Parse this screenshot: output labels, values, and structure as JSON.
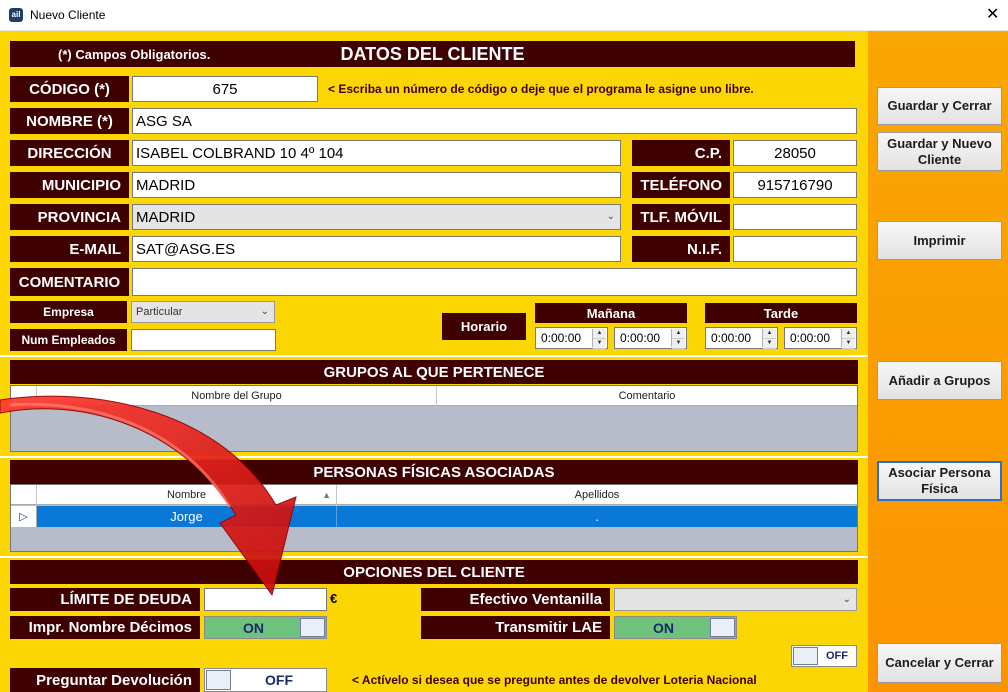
{
  "window": {
    "title": "Nuevo Cliente",
    "close_glyph": "✕",
    "app_icon_text": "ail"
  },
  "header": {
    "required_note": "(*) Campos Obligatorios.",
    "title": "DATOS DEL CLIENTE"
  },
  "fields": {
    "codigo": {
      "label": "CÓDIGO (*)",
      "value": "675",
      "hint": "< Escriba un número de código o deje que el programa le asigne uno libre."
    },
    "nombre": {
      "label": "NOMBRE (*)",
      "value": "ASG SA"
    },
    "direccion": {
      "label": "DIRECCIÓN",
      "value": "ISABEL COLBRAND 10 4º 104"
    },
    "cp": {
      "label": "C.P.",
      "value": "28050"
    },
    "municipio": {
      "label": "MUNICIPIO",
      "value": "MADRID"
    },
    "telefono": {
      "label": "TELÉFONO",
      "value": "915716790"
    },
    "provincia": {
      "label": "PROVINCIA",
      "value": "MADRID"
    },
    "movil": {
      "label": "TLF. MÓVIL",
      "value": ""
    },
    "email": {
      "label": "E-MAIL",
      "value": "SAT@ASG.ES"
    },
    "nif": {
      "label": "N.I.F.",
      "value": ""
    },
    "comentario": {
      "label": "COMENTARIO",
      "value": ""
    },
    "empresa": {
      "label": "Empresa",
      "value": "Particular"
    },
    "num_empleados": {
      "label": "Num Empleados",
      "value": ""
    }
  },
  "horario": {
    "label": "Horario",
    "manana": {
      "label": "Mañana",
      "from": "0:00:00",
      "to": "0:00:00"
    },
    "tarde": {
      "label": "Tarde",
      "from": "0:00:00",
      "to": "0:00:00"
    }
  },
  "grupos": {
    "title": "GRUPOS AL QUE PERTENECE",
    "columns": [
      "Nombre del Grupo",
      "Comentario"
    ]
  },
  "personas": {
    "title": "PERSONAS FÍSICAS ASOCIADAS",
    "columns": [
      "Nombre",
      "Apellidos"
    ],
    "rows": [
      {
        "marker": "▷",
        "nombre": "Jorge",
        "apellidos": "."
      }
    ]
  },
  "opciones": {
    "title": "OPCIONES DEL CLIENTE",
    "limite_deuda": {
      "label": "LÍMITE DE DEUDA",
      "value": "",
      "currency": "€"
    },
    "efectivo_ventanilla": {
      "label": "Efectivo Ventanilla",
      "value": ""
    },
    "impr_nombre_decimos": {
      "label": "Impr. Nombre Décimos",
      "state": "ON"
    },
    "transmitir_lae": {
      "label": "Transmitir LAE",
      "state": "ON"
    },
    "extra_toggle": {
      "state": "OFF"
    },
    "preguntar_devolucion": {
      "label": "Preguntar Devolución",
      "state": "OFF",
      "hint": "<  Actívelo si desea que se pregunte antes de devolver Loteria Nacional"
    }
  },
  "sidebar": {
    "guardar_cerrar": "Guardar y Cerrar",
    "guardar_nuevo": "Guardar y Nuevo Cliente",
    "imprimir": "Imprimir",
    "anadir_grupos": "Añadir a Grupos",
    "asociar_persona": "Asociar Persona Física",
    "cancelar_cerrar": "Cancelar y Cerrar"
  },
  "colors": {
    "form_bg": "#fcd603",
    "label_bg": "#3e0000",
    "sidebar_bg": "#f9a705",
    "selected_row": "#0a78d7",
    "toggle_on": "#6fc27d",
    "arrow": "#e11515"
  }
}
